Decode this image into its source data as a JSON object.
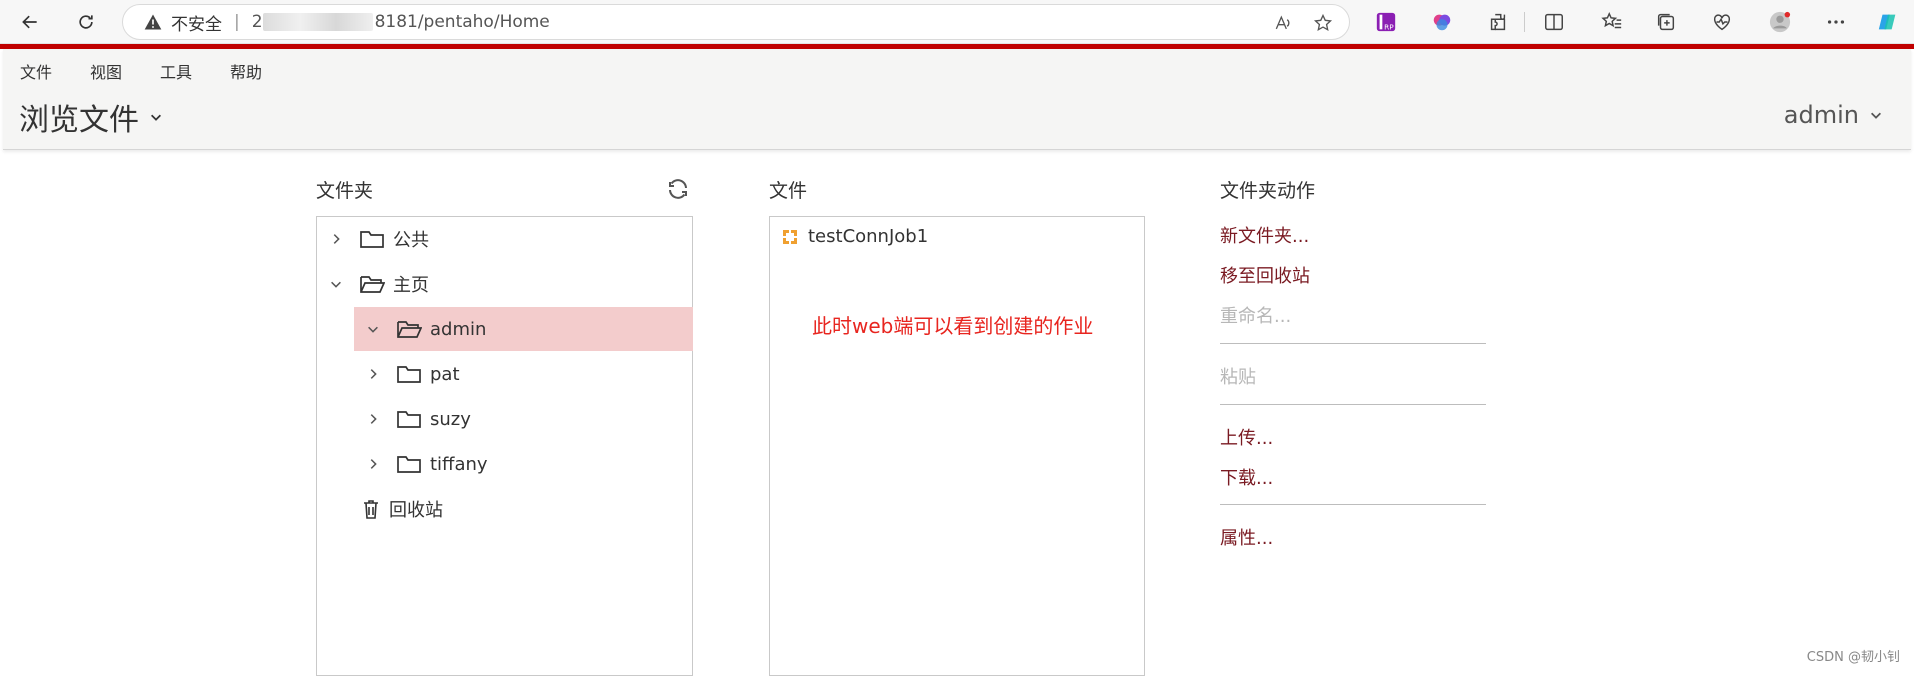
{
  "browser": {
    "insecure_label": "不安全",
    "address_prefix": "2",
    "address_suffix": "8181/pentaho/Home",
    "read_aloud": "A⁾"
  },
  "menu": {
    "items": [
      "文件",
      "视图",
      "工具",
      "帮助"
    ]
  },
  "header": {
    "title": "浏览文件",
    "user": "admin"
  },
  "folders_panel": {
    "title": "文件夹",
    "tree": [
      {
        "label": "公共",
        "expanded": false,
        "level": 0,
        "icon": "folder-icon"
      },
      {
        "label": "主页",
        "expanded": true,
        "level": 0,
        "icon": "folder-open-icon"
      },
      {
        "label": "admin",
        "expanded": true,
        "level": 1,
        "icon": "folder-open-icon",
        "selected": true
      },
      {
        "label": "pat",
        "expanded": false,
        "level": 1,
        "icon": "folder-icon"
      },
      {
        "label": "suzy",
        "expanded": false,
        "level": 1,
        "icon": "folder-icon"
      },
      {
        "label": "tiffany",
        "expanded": false,
        "level": 1,
        "icon": "folder-icon"
      },
      {
        "label": "回收站",
        "level": 0,
        "icon": "trash-icon"
      }
    ]
  },
  "files_panel": {
    "title": "文件",
    "files": [
      {
        "name": "testConnJob1",
        "icon": "job-icon"
      }
    ],
    "annotation": "此时web端可以看到创建的作业"
  },
  "actions_panel": {
    "title": "文件夹动作",
    "items": [
      {
        "label": "新文件夹...",
        "enabled": true
      },
      {
        "label": "移至回收站",
        "enabled": true
      },
      {
        "label": "重命名...",
        "enabled": false
      },
      {
        "label": "粘贴",
        "enabled": false
      },
      {
        "label": "上传...",
        "enabled": true
      },
      {
        "label": "下载...",
        "enabled": true
      },
      {
        "label": "属性...",
        "enabled": true
      }
    ]
  },
  "watermark": "CSDN @韧小钊",
  "colors": {
    "accent_red": "#c00000",
    "selected_row": "#f3cccc",
    "action_link": "#7a1a22",
    "annotation": "#e8251f"
  }
}
